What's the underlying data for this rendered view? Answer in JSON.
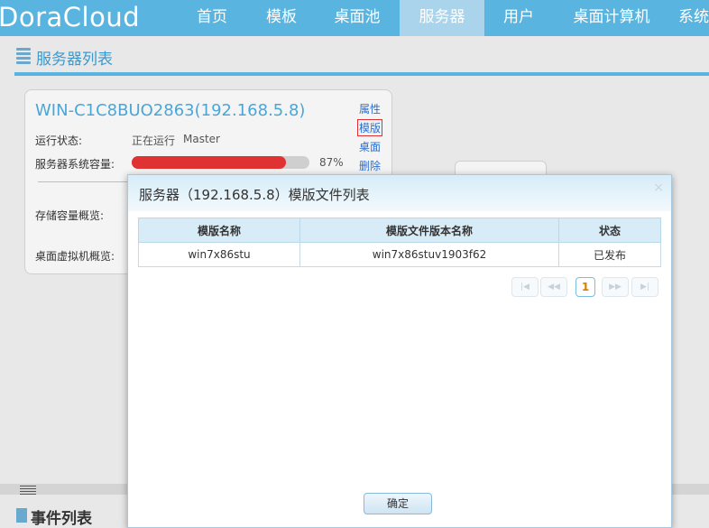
{
  "app": {
    "logo": "DoraCloud"
  },
  "nav": {
    "items": [
      {
        "label": "首页"
      },
      {
        "label": "模板"
      },
      {
        "label": "桌面池"
      },
      {
        "label": "服务器"
      },
      {
        "label": "用户"
      },
      {
        "label": "桌面计算机"
      },
      {
        "label": "系统"
      }
    ],
    "active": "服务器"
  },
  "page": {
    "title": "服务器列表"
  },
  "server_card": {
    "name": "WIN-C1C8BUO2863(192.168.5.8)",
    "status_label": "运行状态:",
    "status_value": "正在运行",
    "status_role": "Master",
    "capacity_label": "服务器系统容量:",
    "capacity_percent": 87,
    "capacity_text": "87%",
    "storage_label": "存储容量概览:",
    "vm_label": "桌面虚拟机概览:",
    "actions": [
      {
        "label": "属性"
      },
      {
        "label": "模版"
      },
      {
        "label": "桌面"
      },
      {
        "label": "删除"
      }
    ]
  },
  "bottom": {
    "title": "事件列表"
  },
  "modal": {
    "title": "服务器（192.168.5.8）模版文件列表",
    "close": "×",
    "table": {
      "columns": [
        "模版名称",
        "模版文件版本名称",
        "状态"
      ],
      "rows": [
        [
          "win7x86stu",
          "win7x86stuv1903f62",
          "已发布"
        ]
      ]
    },
    "pager": {
      "first": "|◀",
      "prev": "◀◀",
      "page": "1",
      "next": "▶▶",
      "last": "▶|"
    },
    "ok_label": "确定"
  },
  "colors": {
    "accent": "#5ab4e0",
    "nav_active": "#a9d4ec",
    "capacity_bar": "#e03232",
    "link": "#2a6fcf"
  }
}
